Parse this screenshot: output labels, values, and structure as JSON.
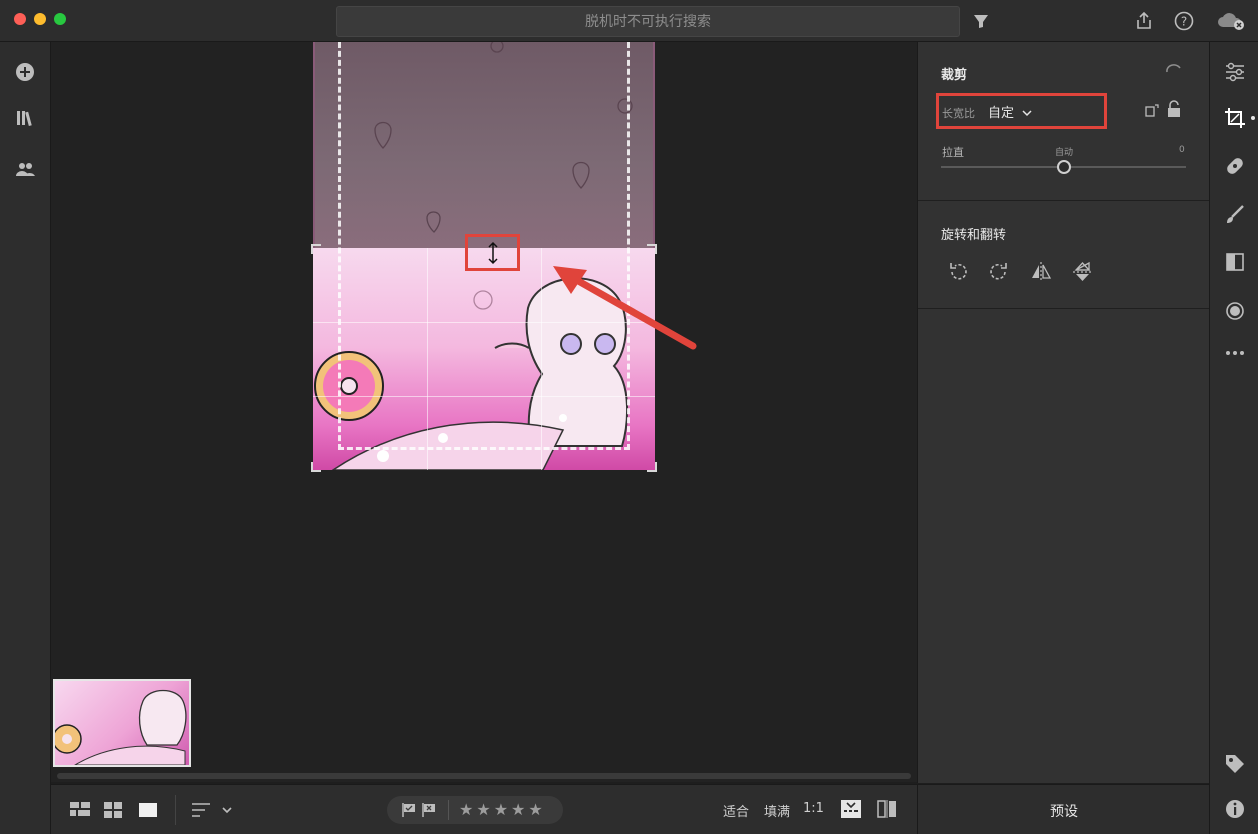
{
  "search": {
    "placeholder": "脱机时不可执行搜索"
  },
  "crop_panel": {
    "title": "裁剪",
    "aspect_label": "长宽比",
    "aspect_value": "自定",
    "straighten_label": "拉直",
    "straighten_auto": "自动",
    "straighten_value": "0",
    "straighten_level": 0.5
  },
  "rotate_panel": {
    "title": "旋转和翻转"
  },
  "bottom_bar": {
    "fit_label": "适合",
    "fill_label": "填满",
    "ratio_label": "1:1",
    "stars": "★★★★★"
  },
  "presets": {
    "label": "预设"
  },
  "colors": {
    "accent_red": "#e0443b",
    "panel_bg": "#323232",
    "canvas_bg": "#222222"
  },
  "icons": {
    "titlebar": [
      "filter-icon",
      "share-icon",
      "help-icon",
      "cloud-status-icon"
    ],
    "left_rail": [
      "add-photos-icon",
      "library-icon",
      "people-icon"
    ],
    "tool_rail": [
      "sliders-icon",
      "crop-icon",
      "heal-icon",
      "brush-icon",
      "linear-gradient-icon",
      "radial-gradient-icon",
      "more-icon",
      "tag-icon",
      "info-icon"
    ]
  }
}
